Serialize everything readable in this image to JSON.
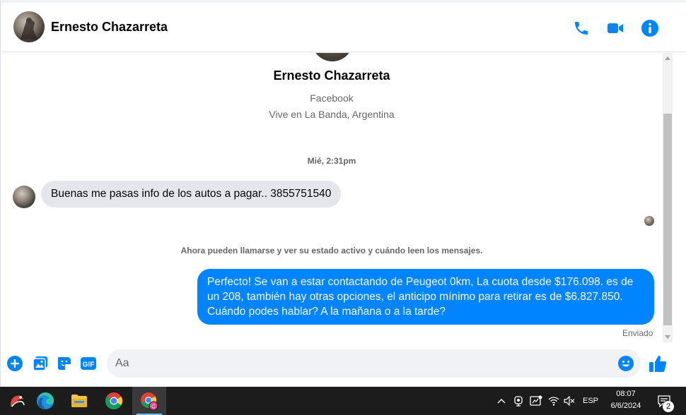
{
  "header": {
    "contact_name": "Ernesto Chazarreta",
    "call_icon": "phone-icon",
    "video_icon": "video-camera-icon",
    "info_icon": "info-icon"
  },
  "profile": {
    "name": "Ernesto Chazarreta",
    "source": "Facebook",
    "location": "Vive en La Banda, Argentina"
  },
  "conversation": {
    "timestamp": "Mié, 2:31pm",
    "incoming_message": "Buenas me pasas info de los autos a pagar.. 3855751540",
    "notice": "Ahora pueden llamarse y ver su estado activo y cuándo leen los mensajes.",
    "outgoing_message": "Perfecto!  Se van a estar contactando de Peugeot 0km, La cuota desde $176.098. es de un 208, también hay otras opciones, el anticipo mínimo para retirar es de $6.827.850. Cuándo podes hablar? A la mañana o a la tarde?",
    "status": "Enviado"
  },
  "composer": {
    "placeholder": "Aa",
    "value": "",
    "gif_label": "GIF"
  },
  "colors": {
    "accent": "#0084ff",
    "incoming_bubble": "#e4e6eb",
    "muted_text": "#65676b",
    "taskbar": "#1c1c1c"
  },
  "taskbar": {
    "language": "ESP",
    "time": "08:07",
    "date": "6/6/2024",
    "notification_count": "2"
  }
}
